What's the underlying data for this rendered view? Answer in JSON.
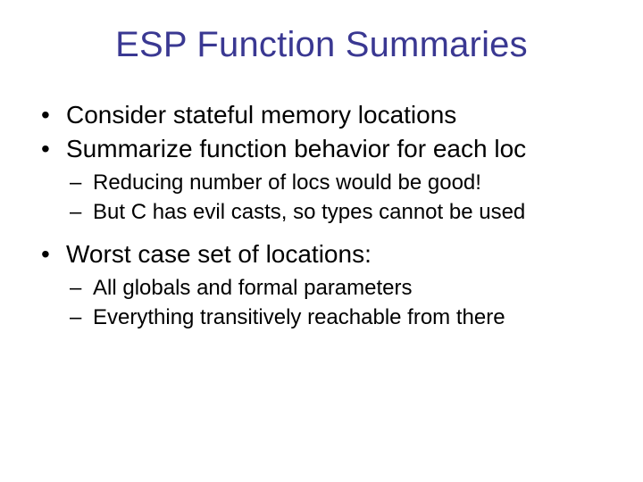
{
  "title": "ESP Function Summaries",
  "bullets": [
    {
      "text": "Consider stateful memory locations",
      "sub": []
    },
    {
      "text": "Summarize function behavior for each loc",
      "sub": [
        "Reducing number of locs would be good!",
        "But C has evil casts, so types cannot be used"
      ]
    },
    {
      "text": "Worst case set of locations:",
      "sub": [
        "All globals and formal parameters",
        "Everything transitively reachable from there"
      ]
    }
  ]
}
